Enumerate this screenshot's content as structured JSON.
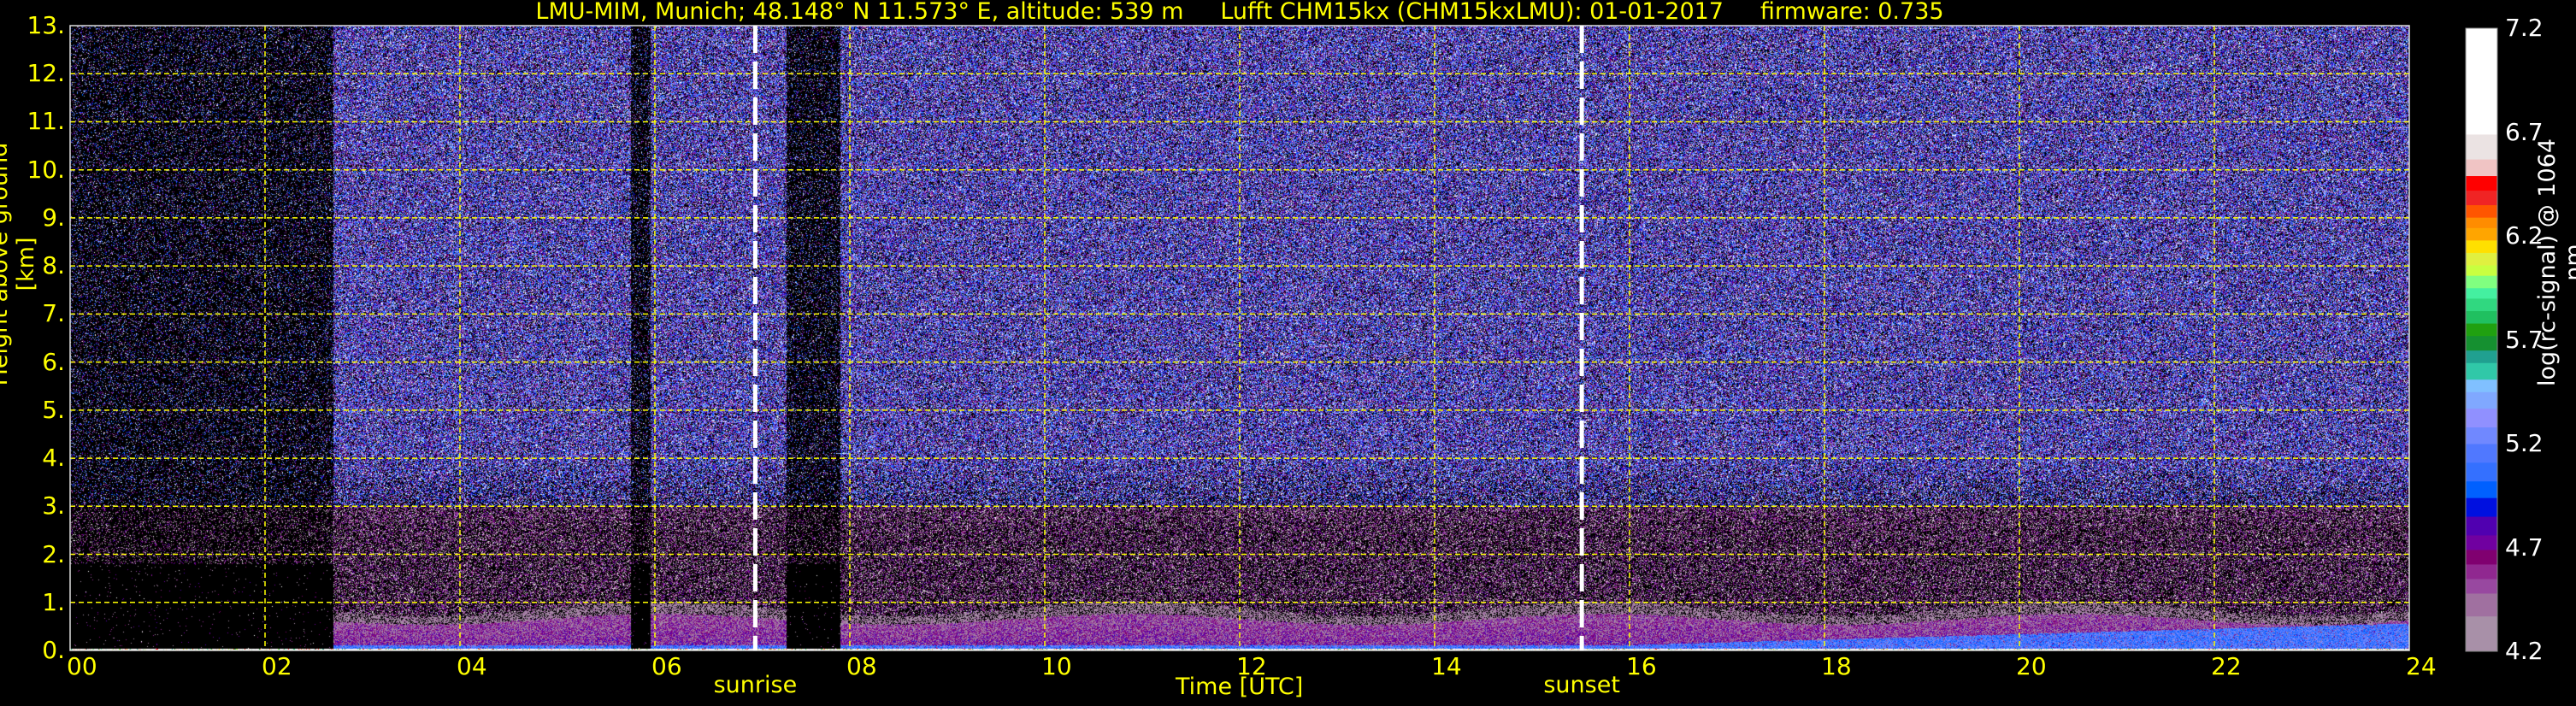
{
  "title": "LMU-MIM, Munich; 48.148° N 11.573° E, altitude: 539 m     Lufft CHM15kx (CHM15kxLMU): 01-01-2017     firmware: 0.735",
  "colors": {
    "text": "#ffff00",
    "grid": "#ffff00",
    "background": "#000000",
    "event_lines": "#ffffff",
    "colorbar_text": "#ffffff"
  },
  "chart_data": {
    "type": "heatmap",
    "title": "LMU-MIM, Munich; 48.148° N 11.573° E, altitude: 539 m     Lufft CHM15kx (CHM15kxLMU): 01-01-2017     firmware: 0.735",
    "xlabel": "Time [UTC]",
    "ylabel": "Height above ground [km]",
    "xlim": [
      0,
      24
    ],
    "ylim": [
      0,
      13
    ],
    "grid": true,
    "x_ticks": [
      "00",
      "02",
      "04",
      "06",
      "08",
      "10",
      "12",
      "14",
      "16",
      "18",
      "20",
      "22",
      "24"
    ],
    "y_ticks": [
      "0.",
      "1.",
      "2.",
      "3.",
      "4.",
      "5.",
      "6.",
      "7.",
      "8.",
      "9.",
      "10.",
      "11.",
      "12.",
      "13."
    ],
    "events": [
      {
        "label": "sunrise",
        "time": 7.03
      },
      {
        "label": "sunset",
        "time": 15.51
      }
    ],
    "colorbar": {
      "label": "log(rc-signal) @ 1064 nm",
      "ticks": [
        "4.2",
        "4.7",
        "5.2",
        "5.7",
        "6.2",
        "6.7",
        "7.2"
      ],
      "range": [
        4.2,
        7.2
      ],
      "levels": [
        4.2,
        4.37,
        4.48,
        4.55,
        4.62,
        4.69,
        4.76,
        4.85,
        4.94,
        5.02,
        5.11,
        5.2,
        5.28,
        5.37,
        5.45,
        5.51,
        5.59,
        5.65,
        5.72,
        5.78,
        5.84,
        5.9,
        5.95,
        6.01,
        6.06,
        6.12,
        6.18,
        6.24,
        6.29,
        6.35,
        6.42,
        6.49,
        6.57,
        6.69,
        7.2
      ],
      "colors": [
        "#a890a8",
        "#a070a0",
        "#9848a0",
        "#902890",
        "#800070",
        "#7000a0",
        "#5000b0",
        "#0010e0",
        "#0060ff",
        "#3470ff",
        "#5078ff",
        "#7088ff",
        "#9090ff",
        "#80a8ff",
        "#80c0ff",
        "#30c8a8",
        "#20a090",
        "#159030",
        "#20a010",
        "#20c060",
        "#30d880",
        "#44f0a0",
        "#80ff80",
        "#c8ff40",
        "#e0f040",
        "#ffe000",
        "#ffa500",
        "#ff8c00",
        "#ff5500",
        "#f02424",
        "#ff0000",
        "#f0c4c4",
        "#ebe3e3",
        "#ffffff"
      ]
    },
    "features": {
      "boundary_layer_top_km": 1.0,
      "night_clear_until_utc": 2.7,
      "signal_gaps_utc": [
        [
          5.75,
          5.95
        ],
        [
          7.35,
          7.9
        ]
      ],
      "blue_layer_thickening_from_utc": 16
    }
  }
}
